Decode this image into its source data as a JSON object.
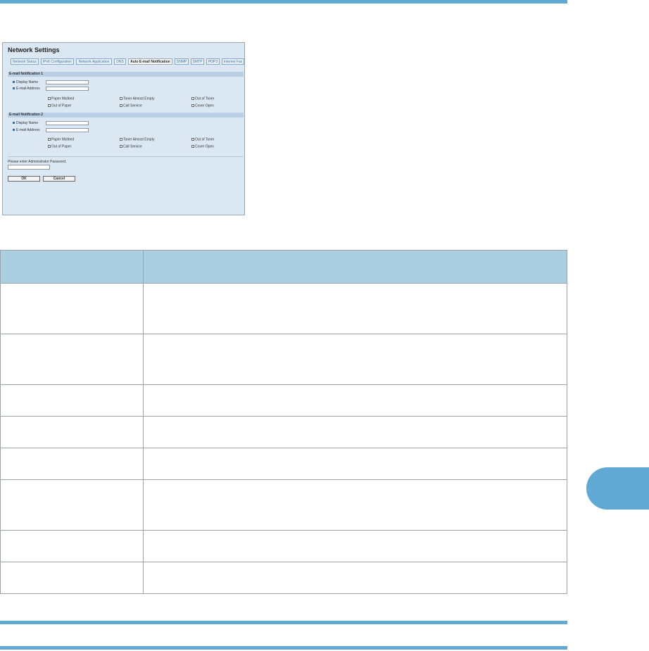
{
  "panel": {
    "title": "Network Settings",
    "tabs": [
      "Network Status",
      "IPv6 Configuration",
      "Network Application",
      "DNS",
      "Auto E-mail Notification",
      "SNMP",
      "SMTP",
      "POP3",
      "Internet Fax"
    ],
    "active_tab": "Auto E-mail Notification",
    "sections": [
      {
        "heading": "E-mail Notification 1",
        "display_name_label": "Display Name",
        "email_label": "E-mail Address",
        "checkboxes": [
          "Paper Misfeed",
          "Toner Almost Empty",
          "Out of Toner",
          "Out of Paper",
          "Call Service",
          "Cover Open"
        ]
      },
      {
        "heading": "E-mail Notification 2",
        "display_name_label": "Display Name",
        "email_label": "E-mail Address",
        "checkboxes": [
          "Paper Misfeed",
          "Toner Almost Empty",
          "Out of Toner",
          "Out of Paper",
          "Call Service",
          "Cover Open"
        ]
      }
    ],
    "password_label": "Please enter Administrator Password.",
    "ok_label": "OK",
    "cancel_label": "Cancel"
  }
}
